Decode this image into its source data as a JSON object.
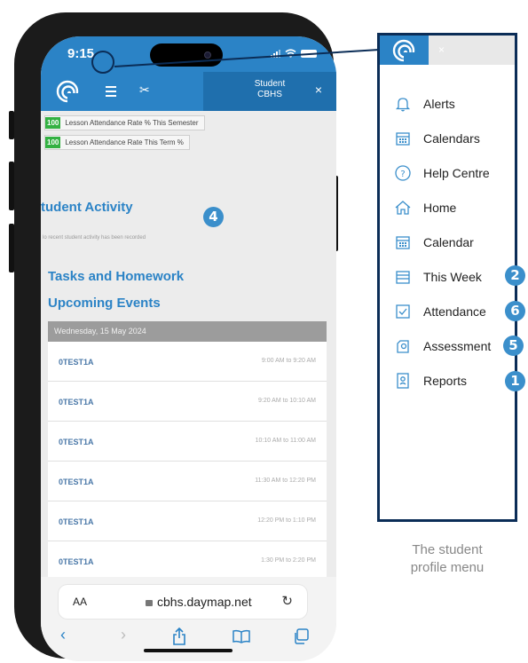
{
  "status": {
    "time": "9:15"
  },
  "appbar": {
    "student_label": "Student",
    "student_school": "CBHS",
    "close": "×"
  },
  "stats": [
    {
      "value": "100",
      "label": "Lesson Attendance Rate % This Semester"
    },
    {
      "value": "100",
      "label": "Lesson Attendance Rate This Term %"
    }
  ],
  "sections": {
    "student_activity": "tudent Activity",
    "activity_empty": "lo recent student activity has been recorded",
    "tasks": "Tasks and Homework",
    "events": "Upcoming Events"
  },
  "events": {
    "date_header": "Wednesday, 15 May 2024",
    "rows": [
      {
        "name": "0TEST1A",
        "time": "9:00 AM to 9:20 AM"
      },
      {
        "name": "0TEST1A",
        "time": "9:20 AM to 10:10 AM"
      },
      {
        "name": "0TEST1A",
        "time": "10:10 AM to 11:00 AM"
      },
      {
        "name": "0TEST1A",
        "time": "11:30 AM to 12:20 PM"
      },
      {
        "name": "0TEST1A",
        "time": "12:20 PM to 1:10 PM"
      },
      {
        "name": "0TEST1A",
        "time": "1:30 PM to 2:20 PM"
      }
    ]
  },
  "browser": {
    "aa": "AA",
    "url": "cbhs.daymap.net"
  },
  "menu": {
    "items": [
      {
        "label": "Alerts",
        "icon": "bell-icon"
      },
      {
        "label": "Calendars",
        "icon": "calendar-icon"
      },
      {
        "label": "Help Centre",
        "icon": "help-icon"
      },
      {
        "label": "Home",
        "icon": "home-icon"
      },
      {
        "label": "Calendar",
        "icon": "calendar-icon"
      },
      {
        "label": "This Week",
        "icon": "week-icon"
      },
      {
        "label": "Attendance",
        "icon": "checkbox-icon"
      },
      {
        "label": "Assessment",
        "icon": "assessment-icon"
      },
      {
        "label": "Reports",
        "icon": "report-icon"
      }
    ]
  },
  "callouts": {
    "c1": "1",
    "c2": "2",
    "c4": "4",
    "c5": "5",
    "c6": "6"
  },
  "caption": {
    "line1": "The student",
    "line2": "profile menu"
  },
  "colors": {
    "brand_blue": "#2b83c6",
    "callout_blue": "#3b8fcb",
    "frame_navy": "#0b2d57",
    "stat_green": "#33b142"
  }
}
